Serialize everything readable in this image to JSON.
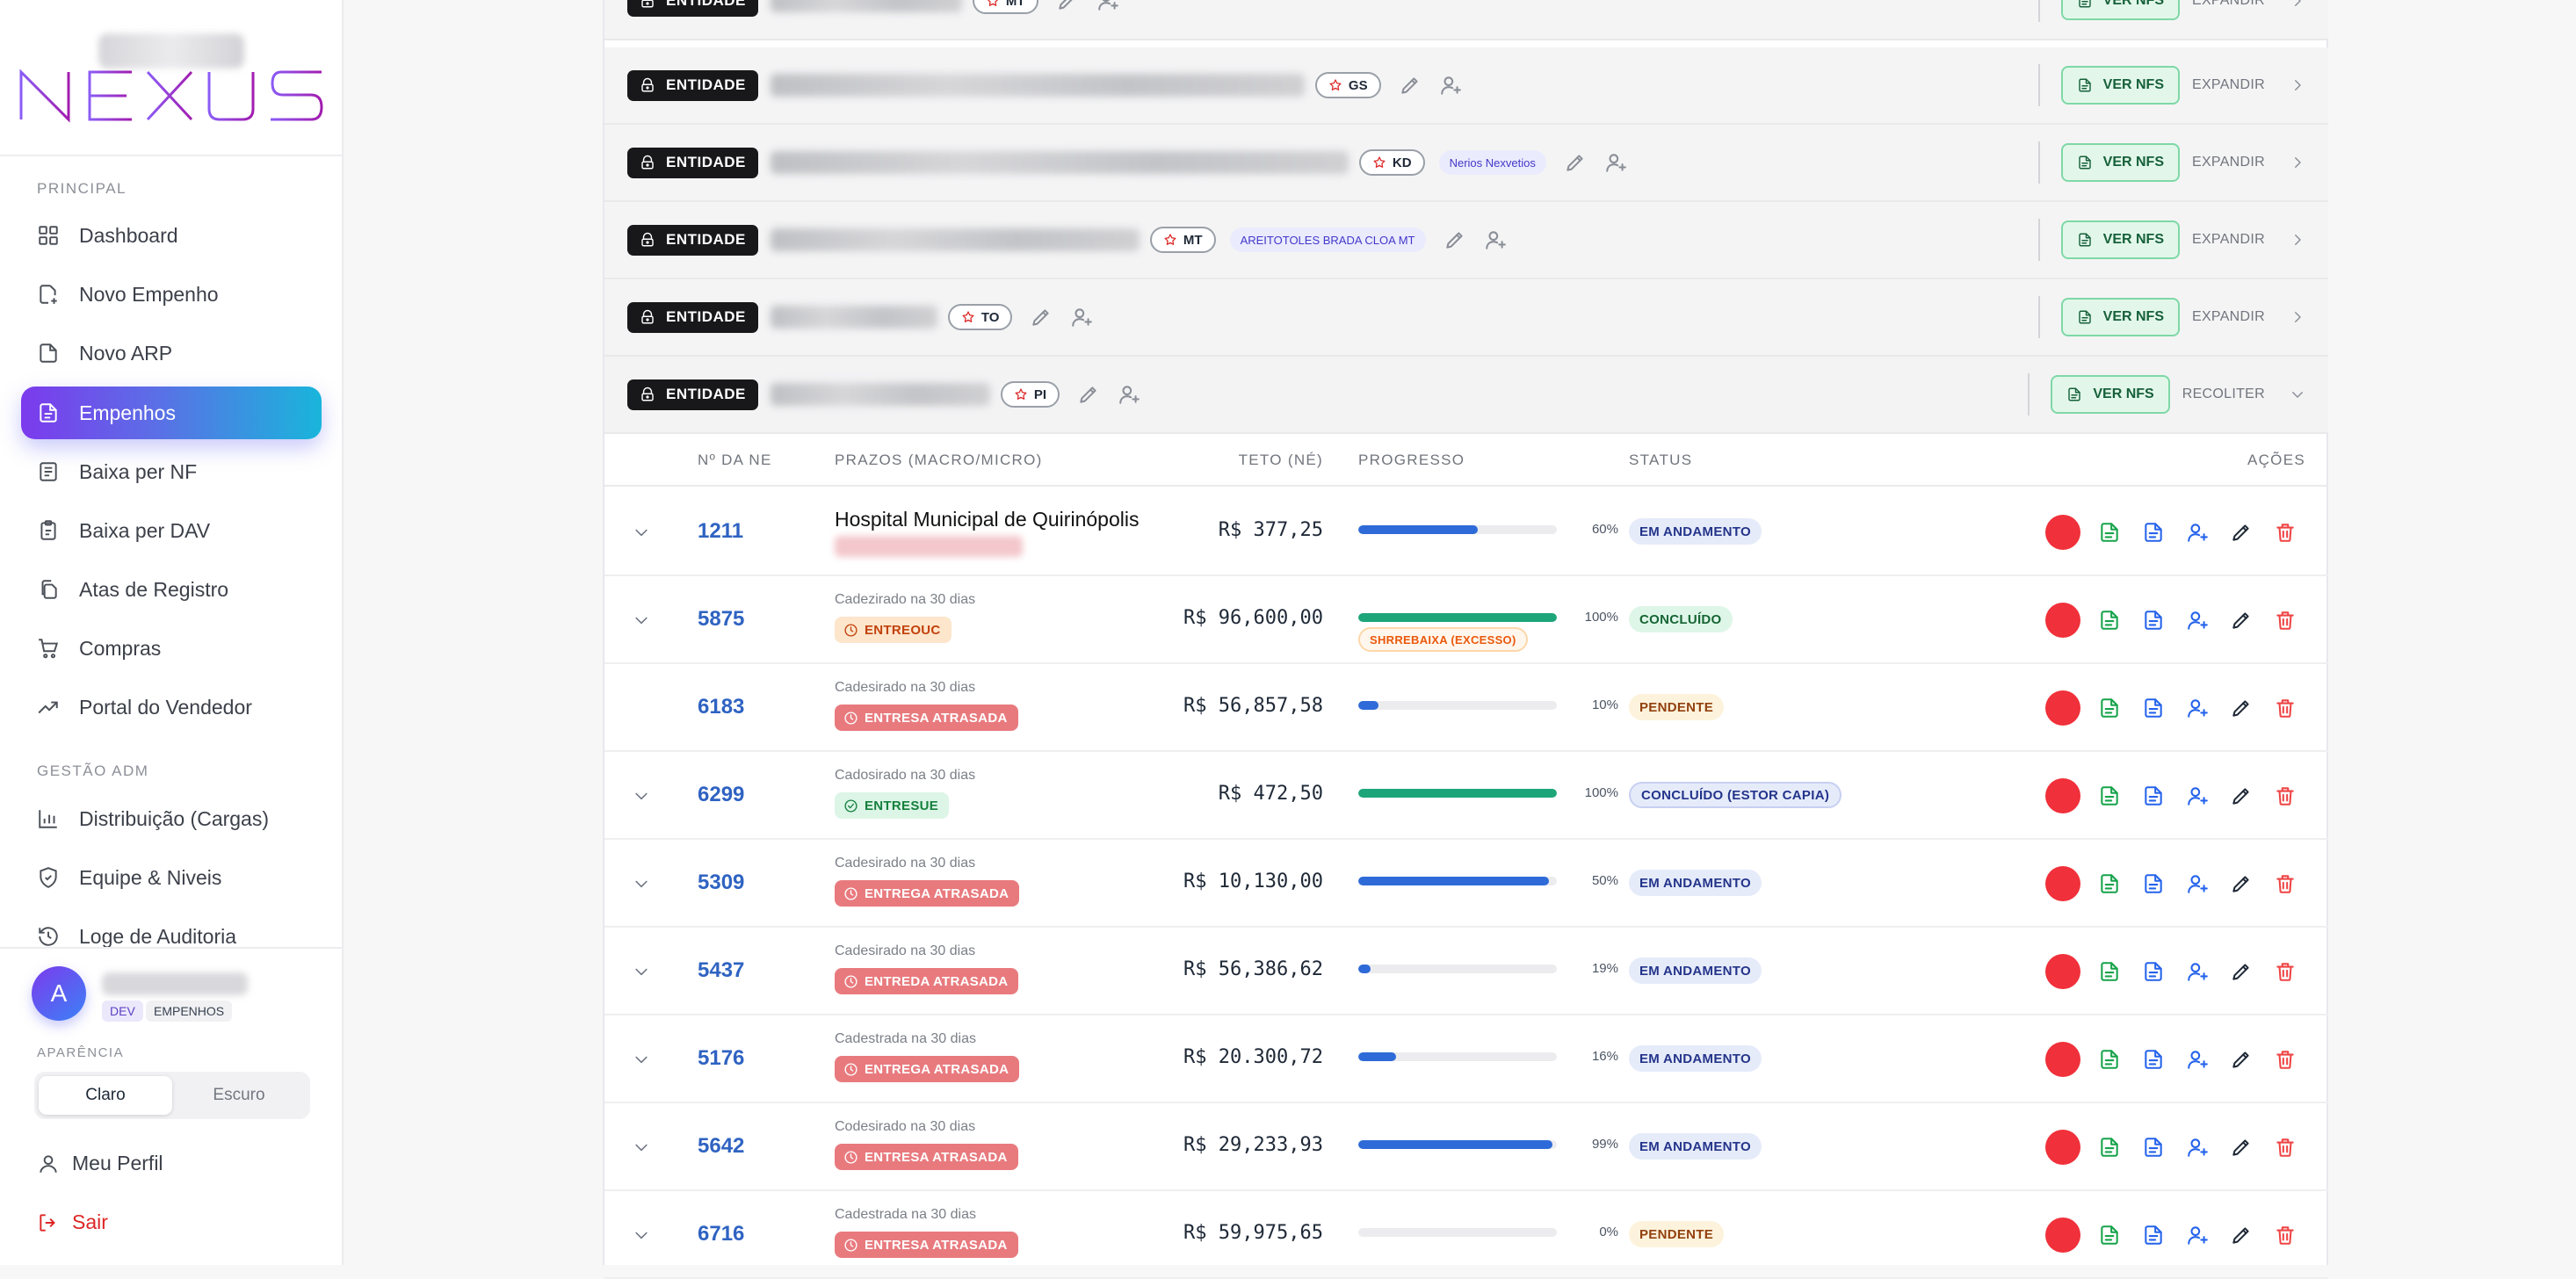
{
  "sidebar": {
    "logo_text": "NEXUS",
    "section_principal": "PRINCIPAL",
    "section_gestao": "GESTÃO ADM",
    "nav": [
      {
        "label": "Dashboard",
        "icon": "grid-icon"
      },
      {
        "label": "Novo Empenho",
        "icon": "file-plus-icon"
      },
      {
        "label": "Novo ARP",
        "icon": "file-icon"
      },
      {
        "label": "Empenhos",
        "icon": "document-icon",
        "active": true
      },
      {
        "label": "Baixa per NF",
        "icon": "receipt-icon"
      },
      {
        "label": "Baixa per DAV",
        "icon": "clipboard-icon"
      },
      {
        "label": "Atas de Registro",
        "icon": "copy-icon"
      },
      {
        "label": "Compras",
        "icon": "cart-icon"
      },
      {
        "label": "Portal do Vendedor",
        "icon": "trending-icon"
      }
    ],
    "nav_admin": [
      {
        "label": "Distribuição (Cargas)",
        "icon": "bar-chart-icon"
      },
      {
        "label": "Equipe & Niveis",
        "icon": "shield-icon"
      },
      {
        "label": "Loge de Auditoria",
        "icon": "history-icon"
      }
    ],
    "user": {
      "initial": "A",
      "tags": [
        "DEV",
        "EMPENHOS"
      ]
    },
    "appearance_title": "APARÊNCIA",
    "theme_options": [
      "Claro",
      "Escuro"
    ],
    "theme_selected": "Claro",
    "profile_label": "Meu Perfil",
    "logout_label": "Sair"
  },
  "entities": [
    {
      "badge": "ENTIDADE",
      "uf": "MT",
      "tenant": "",
      "button": "VER NFS",
      "action": "EXPANDIR",
      "expanded": false
    },
    {
      "badge": "ENTIDADE",
      "uf": "GS",
      "tenant": "",
      "button": "VER NFS",
      "action": "EXPANDIR",
      "expanded": false
    },
    {
      "badge": "ENTIDADE",
      "uf": "KD",
      "tenant": "Nerios Nexvetios",
      "button": "VER NFS",
      "action": "EXPANDIR",
      "expanded": false
    },
    {
      "badge": "ENTIDADE",
      "uf": "MT",
      "tenant": "AREITOTOLES BRADA CLOA MT",
      "button": "VER NFS",
      "action": "EXPANDIR",
      "expanded": false
    },
    {
      "badge": "ENTIDADE",
      "uf": "TO",
      "tenant": "",
      "button": "VER NFS",
      "action": "EXPANDIR",
      "expanded": false
    },
    {
      "badge": "ENTIDADE",
      "uf": "PI",
      "tenant": "",
      "button": "VER NFS",
      "action": "RECOLITER",
      "expanded": true
    }
  ],
  "table": {
    "headers": [
      "Nº DA NE",
      "PRAZOS (MACRO/MICRO)",
      "TETO (NÉ)",
      "PROGRESSO",
      "STATUS",
      "AÇÕES"
    ],
    "rows": [
      {
        "ne": "1211",
        "hospital": "Hospital Municipal de Quirinópolis",
        "cadastro": "",
        "prazo": "",
        "prazo_type": "",
        "value": "R$ 377,25",
        "progress": 60,
        "progress_label": "60%",
        "progress_color": "#2f6bd8",
        "progress_note": "",
        "status": "EM ANDAMENTO",
        "status_type": "and",
        "expandable": true
      },
      {
        "ne": "5875",
        "hospital": "",
        "cadastro": "Cadezirado na 30 dias",
        "prazo": "ENTREOUC",
        "prazo_type": "warn",
        "value": "R$ 96,600,00",
        "progress": 100,
        "progress_label": "100%",
        "progress_color": "#1da57a",
        "progress_note": "SHRREBAIXA (EXCESSO)",
        "status": "CONCLUÍDO",
        "status_type": "con",
        "expandable": true
      },
      {
        "ne": "6183",
        "hospital": "",
        "cadastro": "Cadesirado na 30 dias",
        "prazo": "ENTRESA ATRASADA",
        "prazo_type": "late",
        "value": "R$ 56,857,58",
        "progress": 10,
        "progress_label": "10%",
        "progress_color": "#2f6bd8",
        "progress_note": "",
        "status": "PENDENTE",
        "status_type": "pen",
        "expandable": false
      },
      {
        "ne": "6299",
        "hospital": "",
        "cadastro": "Cadosirado na 30 dias",
        "prazo": "ENTRESUE",
        "prazo_type": "ok",
        "value": "R$ 472,50",
        "progress": 100,
        "progress_label": "100%",
        "progress_color": "#1da57a",
        "progress_note": "",
        "status": "CONCLUÍDO (ESTOR CAPIA)",
        "status_type": "cap",
        "expandable": true
      },
      {
        "ne": "5309",
        "hospital": "",
        "cadastro": "Cadesirado na 30 dias",
        "prazo": "ENTREGA ATRASADA",
        "prazo_type": "late",
        "value": "R$ 10,130,00",
        "progress": 96,
        "progress_label": "50%",
        "progress_color": "#2f6bd8",
        "progress_note": "",
        "status": "EM ANDAMENTO",
        "status_type": "and",
        "expandable": true
      },
      {
        "ne": "5437",
        "hospital": "",
        "cadastro": "Cadesirado na 30 dias",
        "prazo": "ENTREDA ATRASADA",
        "prazo_type": "late",
        "value": "R$ 56,386,62",
        "progress": 6,
        "progress_label": "19%",
        "progress_color": "#2f6bd8",
        "progress_note": "",
        "status": "EM ANDAMENTO",
        "status_type": "and",
        "expandable": true
      },
      {
        "ne": "5176",
        "hospital": "",
        "cadastro": "Cadestrada na 30 dias",
        "prazo": "ENTREGA ATRASADA",
        "prazo_type": "late",
        "value": "R$ 20.300,72",
        "progress": 19,
        "progress_label": "16%",
        "progress_color": "#2f6bd8",
        "progress_note": "",
        "status": "EM ANDAMENTO",
        "status_type": "and",
        "expandable": true
      },
      {
        "ne": "5642",
        "hospital": "",
        "cadastro": "Codesirado na 30 dias",
        "prazo": "ENTRESA ATRASADA",
        "prazo_type": "late",
        "value": "R$ 29,233,93",
        "progress": 98,
        "progress_label": "99%",
        "progress_color": "#2f6bd8",
        "progress_note": "",
        "status": "EM ANDAMENTO",
        "status_type": "and",
        "expandable": true
      },
      {
        "ne": "6716",
        "hospital": "",
        "cadastro": "Cadestrada na 30 dias",
        "prazo": "ENTRESA ATRASADA",
        "prazo_type": "late",
        "value": "R$ 59,975,65",
        "progress": 0,
        "progress_label": "0%",
        "progress_color": "#2f6bd8",
        "progress_note": "",
        "status": "PENDENTE",
        "status_type": "pen",
        "expandable": true
      }
    ]
  },
  "colors": {
    "accent_start": "#7c3aed",
    "accent_end": "#19b5db",
    "danger": "#f0303a",
    "link": "#2f63c2",
    "success": "#1da57a"
  }
}
